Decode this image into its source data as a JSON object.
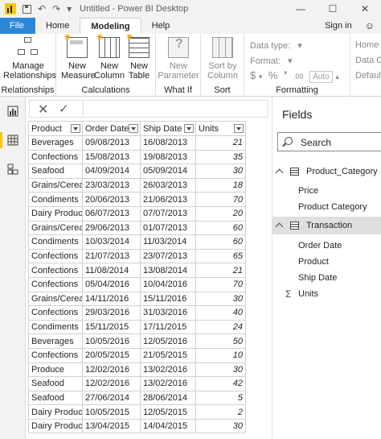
{
  "window": {
    "title": "Untitled - Power BI Desktop"
  },
  "tabs": {
    "file": "File",
    "home": "Home",
    "modeling": "Modeling",
    "help": "Help",
    "signin": "Sign in",
    "smile": "☺"
  },
  "ribbon": {
    "relationships": {
      "button_line1": "Manage",
      "button_line2": "Relationships",
      "group": "Relationships"
    },
    "calculations": {
      "measure_line1": "New",
      "measure_line2": "Measure",
      "column_line1": "New",
      "column_line2": "Column",
      "table_line1": "New",
      "table_line2": "Table",
      "group": "Calculations"
    },
    "whatif": {
      "param_line1": "New",
      "param_line2": "Parameter",
      "group": "What If"
    },
    "sort": {
      "line1": "Sort by",
      "line2": "Column",
      "group": "Sort"
    },
    "formatting": {
      "data_type": "Data type:",
      "format": "Format:",
      "dollar": "$",
      "percent": "%",
      "comma": "❜",
      "decimal": ".00",
      "auto": "Auto",
      "group": "Formatting"
    },
    "properties": {
      "home_table": "Home T",
      "data_category": "Data Ca",
      "default": "Default"
    }
  },
  "formula_bar": {
    "cancel": "✕",
    "commit": "✓"
  },
  "table": {
    "columns": [
      "Product",
      "Order Date",
      "Ship Date",
      "Units"
    ],
    "rows": [
      [
        "Beverages",
        "09/08/2013",
        "16/08/2013",
        "21"
      ],
      [
        "Confections",
        "15/08/2013",
        "19/08/2013",
        "35"
      ],
      [
        "Seafood",
        "04/09/2014",
        "05/09/2014",
        "30"
      ],
      [
        "Grains/Cereals",
        "23/03/2013",
        "26/03/2013",
        "18"
      ],
      [
        "Condiments",
        "20/06/2013",
        "21/06/2013",
        "70"
      ],
      [
        "Dairy Products",
        "06/07/2013",
        "07/07/2013",
        "20"
      ],
      [
        "Grains/Cereals",
        "29/06/2013",
        "01/07/2013",
        "60"
      ],
      [
        "Condiments",
        "10/03/2014",
        "11/03/2014",
        "60"
      ],
      [
        "Confections",
        "21/07/2013",
        "23/07/2013",
        "65"
      ],
      [
        "Confections",
        "11/08/2014",
        "13/08/2014",
        "21"
      ],
      [
        "Confections",
        "05/04/2016",
        "10/04/2016",
        "70"
      ],
      [
        "Grains/Cereals",
        "14/11/2016",
        "15/11/2016",
        "30"
      ],
      [
        "Confections",
        "29/03/2016",
        "31/03/2016",
        "40"
      ],
      [
        "Condiments",
        "15/11/2015",
        "17/11/2015",
        "24"
      ],
      [
        "Beverages",
        "10/05/2016",
        "12/05/2016",
        "50"
      ],
      [
        "Confections",
        "20/05/2015",
        "21/05/2015",
        "10"
      ],
      [
        "Produce",
        "12/02/2016",
        "13/02/2016",
        "30"
      ],
      [
        "Seafood",
        "12/02/2016",
        "13/02/2016",
        "42"
      ],
      [
        "Seafood",
        "27/06/2014",
        "28/06/2014",
        "5"
      ],
      [
        "Dairy Products",
        "10/05/2015",
        "12/05/2015",
        "2"
      ],
      [
        "Dairy Products",
        "13/04/2015",
        "14/04/2015",
        "30"
      ]
    ]
  },
  "fields": {
    "title": "Fields",
    "search_placeholder": "Search",
    "tables": [
      {
        "name": "Product_Category",
        "fields": [
          "Price",
          "Product Category"
        ]
      },
      {
        "name": "Transaction",
        "fields": [
          "Order Date",
          "Product",
          "Ship Date"
        ],
        "measures": [
          "Units"
        ]
      }
    ],
    "sigma_icon": "Σ"
  },
  "icons": {
    "undo": "↶",
    "redo": "↷",
    "qa_more": "▾",
    "minimize": "—",
    "maximize": "☐",
    "close": "✕"
  },
  "colors": {
    "file_tab": "#2b88d8",
    "accent_yellow": "#f2c811",
    "selected_table": "#e1dfdd"
  }
}
